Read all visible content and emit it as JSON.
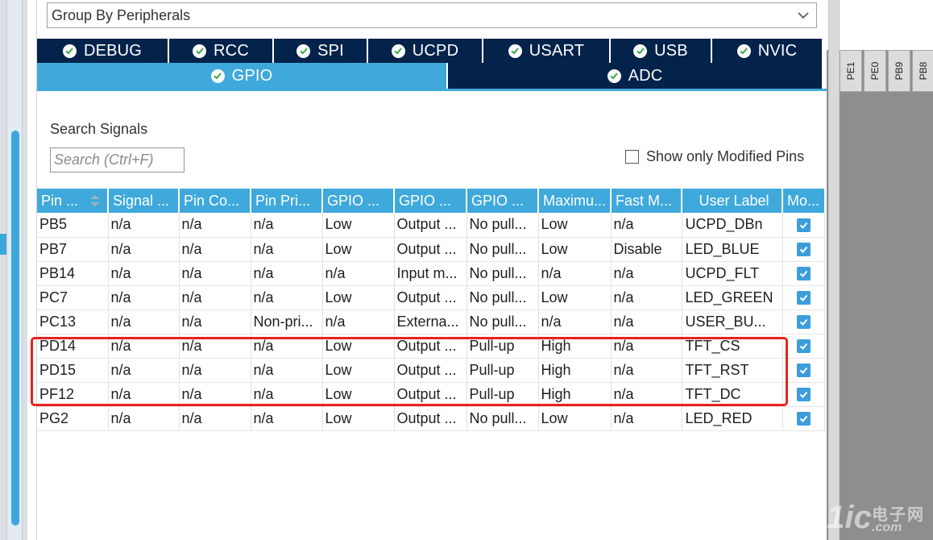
{
  "group_select": {
    "value": "Group By Peripherals"
  },
  "tabs_row1": [
    {
      "label": "DEBUG"
    },
    {
      "label": "RCC"
    },
    {
      "label": "SPI"
    },
    {
      "label": "UCPD"
    },
    {
      "label": "USART"
    },
    {
      "label": "USB"
    },
    {
      "label": "NVIC"
    }
  ],
  "tabs_row2": [
    {
      "label": "GPIO",
      "active": true
    },
    {
      "label": "ADC",
      "active": false
    }
  ],
  "search": {
    "label": "Search Signals",
    "placeholder": "Search (Ctrl+F)"
  },
  "modified_only": {
    "label": "Show only Modified Pins",
    "checked": false
  },
  "pins_strip": [
    "PE1",
    "PE0",
    "PB9",
    "PB8"
  ],
  "table": {
    "headers": [
      "Pin ...",
      "Signal ...",
      "Pin Co...",
      "Pin Pri...",
      "GPIO ...",
      "GPIO ...",
      "GPIO ...",
      "Maximu...",
      "Fast M...",
      "User Label",
      "Mo..."
    ],
    "rows": [
      [
        "PB5",
        "n/a",
        "n/a",
        "n/a",
        "Low",
        "Output ...",
        "No pull...",
        "Low",
        "n/a",
        "UCPD_DBn"
      ],
      [
        "PB7",
        "n/a",
        "n/a",
        "n/a",
        "Low",
        "Output ...",
        "No pull...",
        "Low",
        "Disable",
        "LED_BLUE"
      ],
      [
        "PB14",
        "n/a",
        "n/a",
        "n/a",
        "n/a",
        "Input m...",
        "No pull...",
        "n/a",
        "n/a",
        "UCPD_FLT"
      ],
      [
        "PC7",
        "n/a",
        "n/a",
        "n/a",
        "Low",
        "Output ...",
        "No pull...",
        "Low",
        "n/a",
        "LED_GREEN"
      ],
      [
        "PC13",
        "n/a",
        "n/a",
        "Non-pri...",
        "n/a",
        "Externa...",
        "No pull...",
        "n/a",
        "n/a",
        "USER_BU..."
      ],
      [
        "PD14",
        "n/a",
        "n/a",
        "n/a",
        "Low",
        "Output ...",
        "Pull-up",
        "High",
        "n/a",
        "TFT_CS"
      ],
      [
        "PD15",
        "n/a",
        "n/a",
        "n/a",
        "Low",
        "Output ...",
        "Pull-up",
        "High",
        "n/a",
        "TFT_RST"
      ],
      [
        "PF12",
        "n/a",
        "n/a",
        "n/a",
        "Low",
        "Output ...",
        "Pull-up",
        "High",
        "n/a",
        "TFT_DC"
      ],
      [
        "PG2",
        "n/a",
        "n/a",
        "n/a",
        "Low",
        "Output ...",
        "No pull...",
        "Low",
        "n/a",
        "LED_RED"
      ]
    ],
    "modified": [
      true,
      true,
      true,
      true,
      true,
      true,
      true,
      true,
      true
    ]
  },
  "watermark": {
    "main": "21ic",
    "cn": "电子网",
    "domain": ".com"
  },
  "colors": {
    "tab_dark": "#03234b",
    "tab_active": "#3fa9db",
    "highlight": "#e8211c",
    "checkbox": "#3d9ddb"
  }
}
